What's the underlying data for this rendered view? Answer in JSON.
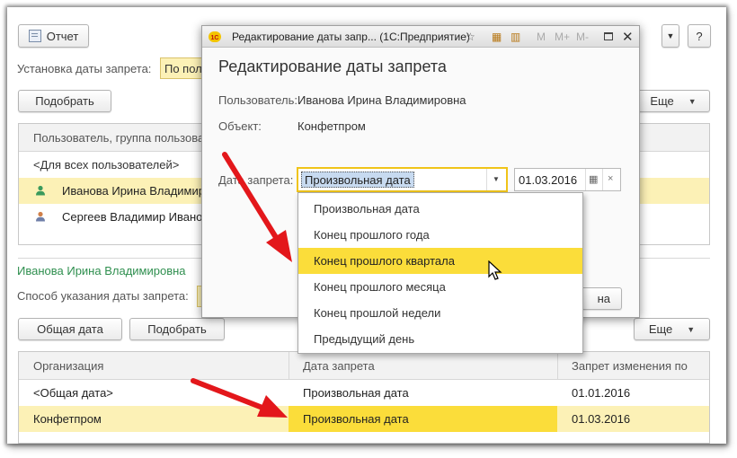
{
  "colors": {
    "accent_yellow": "#fbdd3a",
    "row_yellow": "#fcf1b6",
    "user_green": "#2f8f4f",
    "arrow_red": "#e3171b"
  },
  "toolbar": {
    "report_label": "Отчет",
    "help_label": "?"
  },
  "top": {
    "setup_label": "Установка даты запрета:",
    "setup_value": "По пол",
    "pick_button": "Подобрать",
    "more_button": "Еще"
  },
  "users_grid": {
    "header": "Пользователь, группа пользова",
    "rows": [
      {
        "text": "<Для всех пользователей>",
        "icon": ""
      },
      {
        "text": "Иванова Ирина Владимир",
        "icon": "user-icon"
      },
      {
        "text": "Сергеев Владимир Ивано",
        "icon": "user-icon"
      }
    ]
  },
  "section": {
    "user_name": "Иванова Ирина Владимировна",
    "method_label": "Способ указания даты запрета:",
    "common_date_button": "Общая дата",
    "pick_button": "Подобрать",
    "more_button": "Еще"
  },
  "org_grid": {
    "headers": [
      "Организация",
      "Дата запрета",
      "Запрет изменения по"
    ],
    "rows": [
      [
        "<Общая дата>",
        "Произвольная дата",
        "01.01.2016"
      ],
      [
        "Конфетпром",
        "Произвольная дата",
        "01.03.2016"
      ]
    ]
  },
  "dialog": {
    "window_title": "Редактирование даты запр... (1С:Предприятие)",
    "heading": "Редактирование даты запрета",
    "user_label": "Пользователь:",
    "user_value": "Иванова Ирина Владимировна",
    "object_label": "Объект:",
    "object_value": "Конфетпром",
    "date_label": "Дата запрета:",
    "date_kind_value": "Произвольная дата",
    "date_value": "01.03.2016",
    "cancel_partial": "на",
    "titlebar_icons": [
      "1c-logo-icon",
      "favorite-star-icon",
      "calendar-icon",
      "calculator-icon",
      "m-icon",
      "m-plus-icon",
      "m-minus-icon",
      "maximize-icon",
      "close-icon"
    ],
    "memory_labels": [
      "M",
      "M+",
      "M-"
    ]
  },
  "dropdown_items": [
    "Произвольная дата",
    "Конец прошлого года",
    "Конец прошлого квартала",
    "Конец прошлого месяца",
    "Конец прошлой недели",
    "Предыдущий день"
  ]
}
